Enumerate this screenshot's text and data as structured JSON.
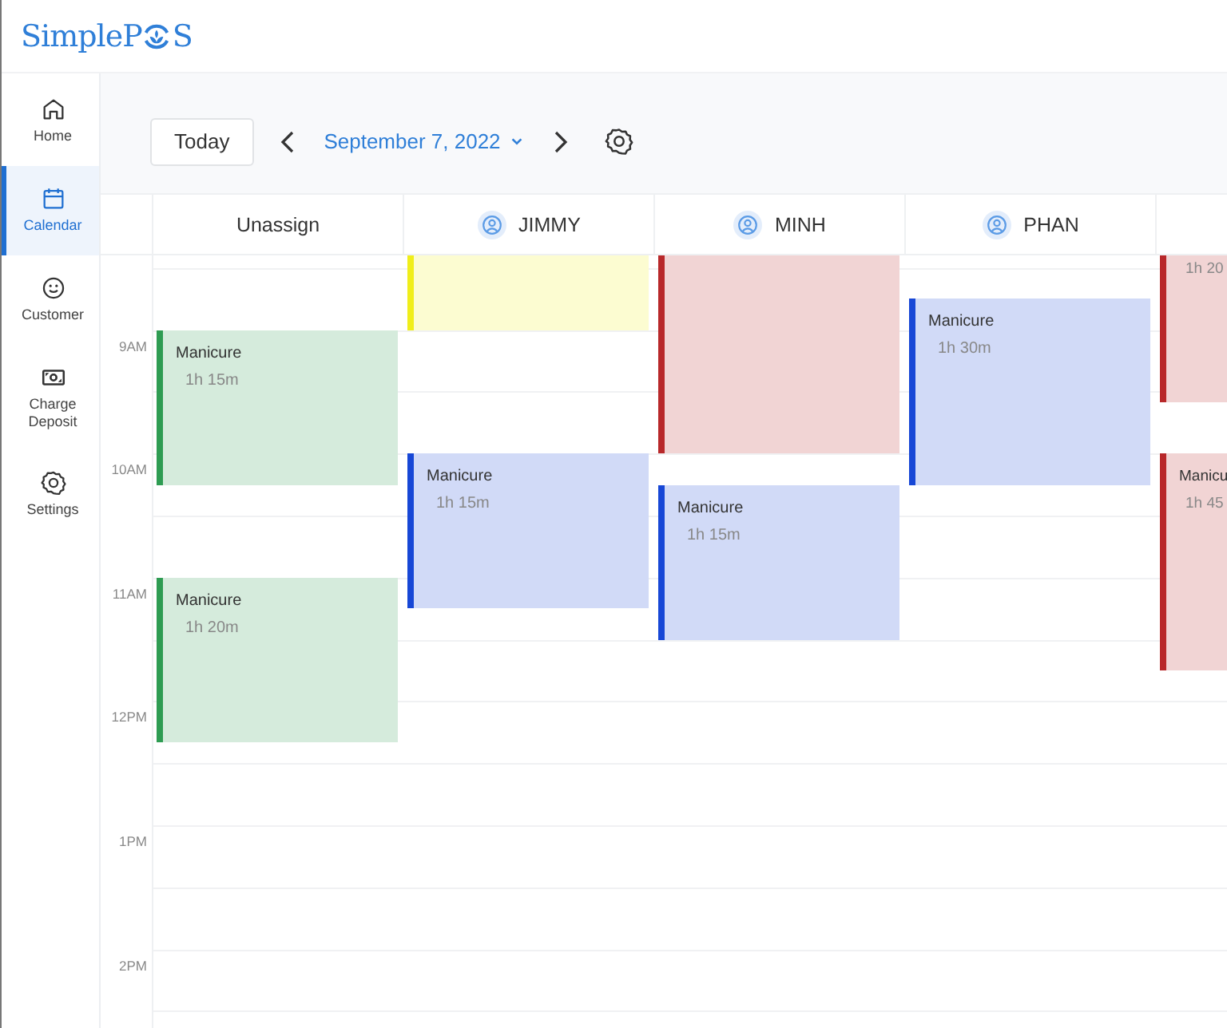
{
  "logo": {
    "before": "SimpleP",
    "after": "S"
  },
  "sidebar": {
    "items": [
      {
        "label": "Home",
        "kind": "home",
        "selected": false
      },
      {
        "label": "Calendar",
        "kind": "calendar",
        "selected": true
      },
      {
        "label": "Customer",
        "kind": "customer",
        "selected": false
      },
      {
        "label": "Charge Deposit",
        "kind": "deposit",
        "selected": false
      },
      {
        "label": "Settings",
        "kind": "settings",
        "selected": false
      }
    ]
  },
  "toolbar": {
    "today": "Today",
    "date": "September 7, 2022"
  },
  "calendar": {
    "hours": [
      "9AM",
      "10AM",
      "11AM",
      "12PM",
      "1PM",
      "2PM"
    ],
    "columns": [
      {
        "name": "Unassign",
        "kind": "unassigned",
        "events": [
          {
            "title": "Manicure",
            "duration": "1h 15m",
            "color": "#2e9c52"
          },
          {
            "title": "Manicure",
            "duration": "1h 20m",
            "color": "#2e9c52"
          }
        ]
      },
      {
        "name": "JIMMY",
        "kind": "staff",
        "events": [
          {
            "color": "#f0ee1a"
          },
          {
            "title": "Manicure",
            "duration": "1h 15m",
            "color": "#1747d6"
          }
        ]
      },
      {
        "name": "MINH",
        "kind": "staff",
        "events": [
          {
            "color": "#b8282a"
          },
          {
            "title": "Manicure",
            "duration": "1h 15m",
            "color": "#1747d6"
          }
        ]
      },
      {
        "name": "PHAN",
        "kind": "staff",
        "events": [
          {
            "title": "Manicure",
            "duration": "1h 30m",
            "color": "#1747d6"
          }
        ]
      },
      {
        "events": [
          {
            "duration": "1h 20",
            "color": "#b8282a"
          },
          {
            "title": "Manicu",
            "duration": "1h 45",
            "color": "#b8282a"
          }
        ]
      }
    ]
  }
}
